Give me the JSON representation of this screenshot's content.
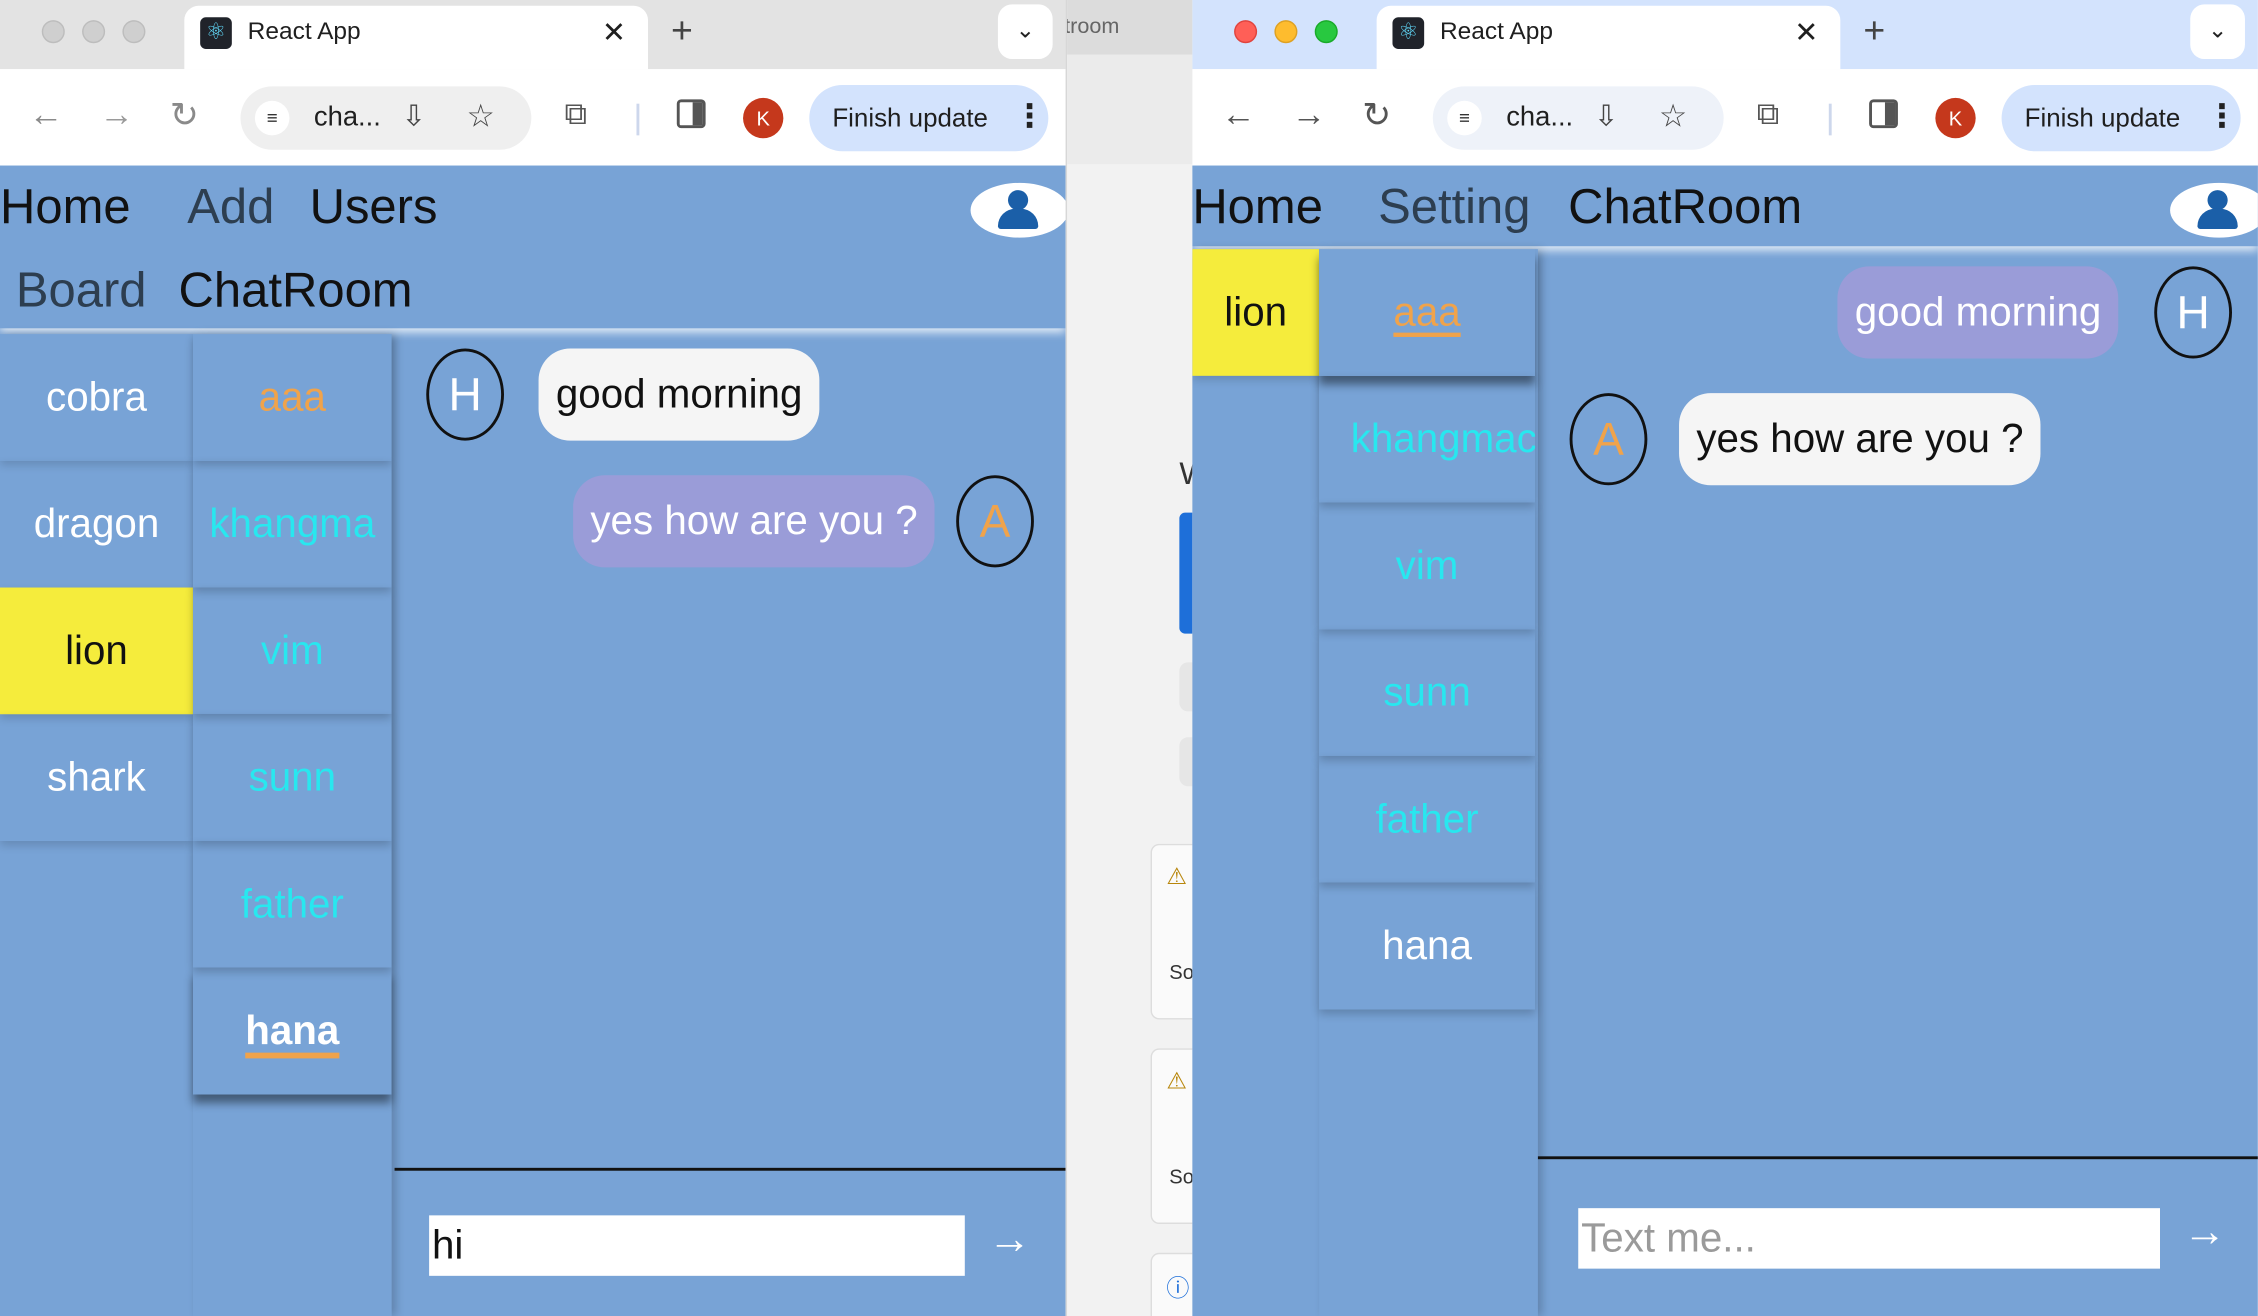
{
  "left_window": {
    "tab_title": "React App",
    "url_short": "cha...",
    "finish_update": "Finish update",
    "avatar_letter": "K",
    "nav": [
      "Home",
      "Add",
      "Users",
      "Board",
      "ChatRoom"
    ],
    "rooms": [
      "cobra",
      "dragon",
      "lion",
      "shark"
    ],
    "active_room": "lion",
    "users": [
      "aaa",
      "khangma",
      "vim",
      "sunn",
      "father",
      "hana"
    ],
    "active_user": "hana",
    "messages": [
      {
        "avatar": "H",
        "text": "good morning",
        "side": "left"
      },
      {
        "avatar": "A",
        "text": "yes how are you ?",
        "side": "right"
      }
    ],
    "input_value": "hi",
    "send_icon": "→"
  },
  "right_window": {
    "tab_title": "React App",
    "url_short": "cha...",
    "finish_update": "Finish update",
    "avatar_letter": "K",
    "nav": [
      "Home",
      "Setting",
      "ChatRoom"
    ],
    "rooms": [
      "lion"
    ],
    "active_room": "lion",
    "users": [
      "aaa",
      "khangmac",
      "vim",
      "sunn",
      "father",
      "hana"
    ],
    "active_user": "aaa",
    "messages": [
      {
        "avatar": "H",
        "text": "good morning",
        "side": "right"
      },
      {
        "avatar": "A",
        "text": "yes how are you ?",
        "side": "left"
      }
    ],
    "input_placeholder": "Text me...",
    "send_icon": "→"
  },
  "middle_window": {
    "tab_fragment": "troom",
    "w_fragment": "W",
    "so_fragment": "So"
  },
  "icons": {
    "close": "✕",
    "new_tab": "+",
    "tab_search": "⌄",
    "back": "←",
    "forward": "→",
    "reload": "↻",
    "star": "☆",
    "install": "⇩",
    "extensions": "⧉",
    "menu": "⋮",
    "react": "⚛",
    "warning": "⚠",
    "info": "ⓘ"
  },
  "colors": {
    "app_bg": "#78a3d6",
    "active_room_bg": "#f5ec3c",
    "user_cyan": "#28e7ef",
    "user_orange": "#f0a34b",
    "mine_bubble": "#9a9cd8"
  }
}
